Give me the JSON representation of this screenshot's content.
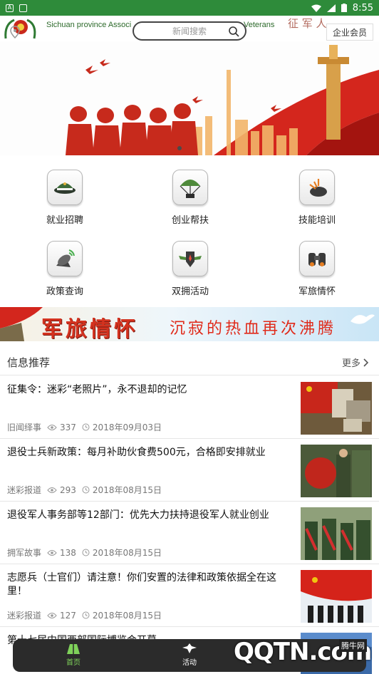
{
  "status_bar": {
    "time": "8:55"
  },
  "header": {
    "org_name": "Sichuan province Associ",
    "org_name_tail": "Veterans",
    "search_placeholder": "新闻搜索",
    "member_label": "企业会员"
  },
  "grid": [
    {
      "label": "就业招聘",
      "icon": "military-cap-icon"
    },
    {
      "label": "创业帮扶",
      "icon": "parachute-icon"
    },
    {
      "label": "技能培训",
      "icon": "gear-badge-icon"
    },
    {
      "label": "政策查询",
      "icon": "radar-dish-icon"
    },
    {
      "label": "双拥活动",
      "icon": "shield-wings-icon"
    },
    {
      "label": "军旅情怀",
      "icon": "binoculars-icon"
    }
  ],
  "ad_banner": {
    "title": "军旅情怀",
    "subtitle": "沉寂的热血再次沸腾"
  },
  "section": {
    "title": "信息推荐",
    "more": "更多"
  },
  "news": [
    {
      "title": "征集令：迷彩“老照片”，永不退却的记忆",
      "category": "旧闻绎事",
      "views": "337",
      "date": "2018年09月03日"
    },
    {
      "title": "退役士兵新政策：每月补助伙食费500元，合格即安排就业",
      "category": "迷彩报道",
      "views": "293",
      "date": "2018年08月15日"
    },
    {
      "title": "退役军人事务部等12部门：优先大力扶持退役军人就业创业",
      "category": "拥军故事",
      "views": "138",
      "date": "2018年08月15日"
    },
    {
      "title": "志愿兵（士官们）请注意！你们安置的法律和政策依据全在这里！",
      "category": "迷彩报道",
      "views": "127",
      "date": "2018年08月15日"
    },
    {
      "title": "第十七届中国西部国际博览会开幕",
      "category": "",
      "views": "",
      "date": ""
    }
  ],
  "bottom_nav": [
    {
      "label": "首页",
      "icon": "home-icon"
    },
    {
      "label": "活动",
      "icon": "activity-icon"
    }
  ],
  "watermark": {
    "main": "QQTN.com",
    "badge": "腾牛网"
  }
}
